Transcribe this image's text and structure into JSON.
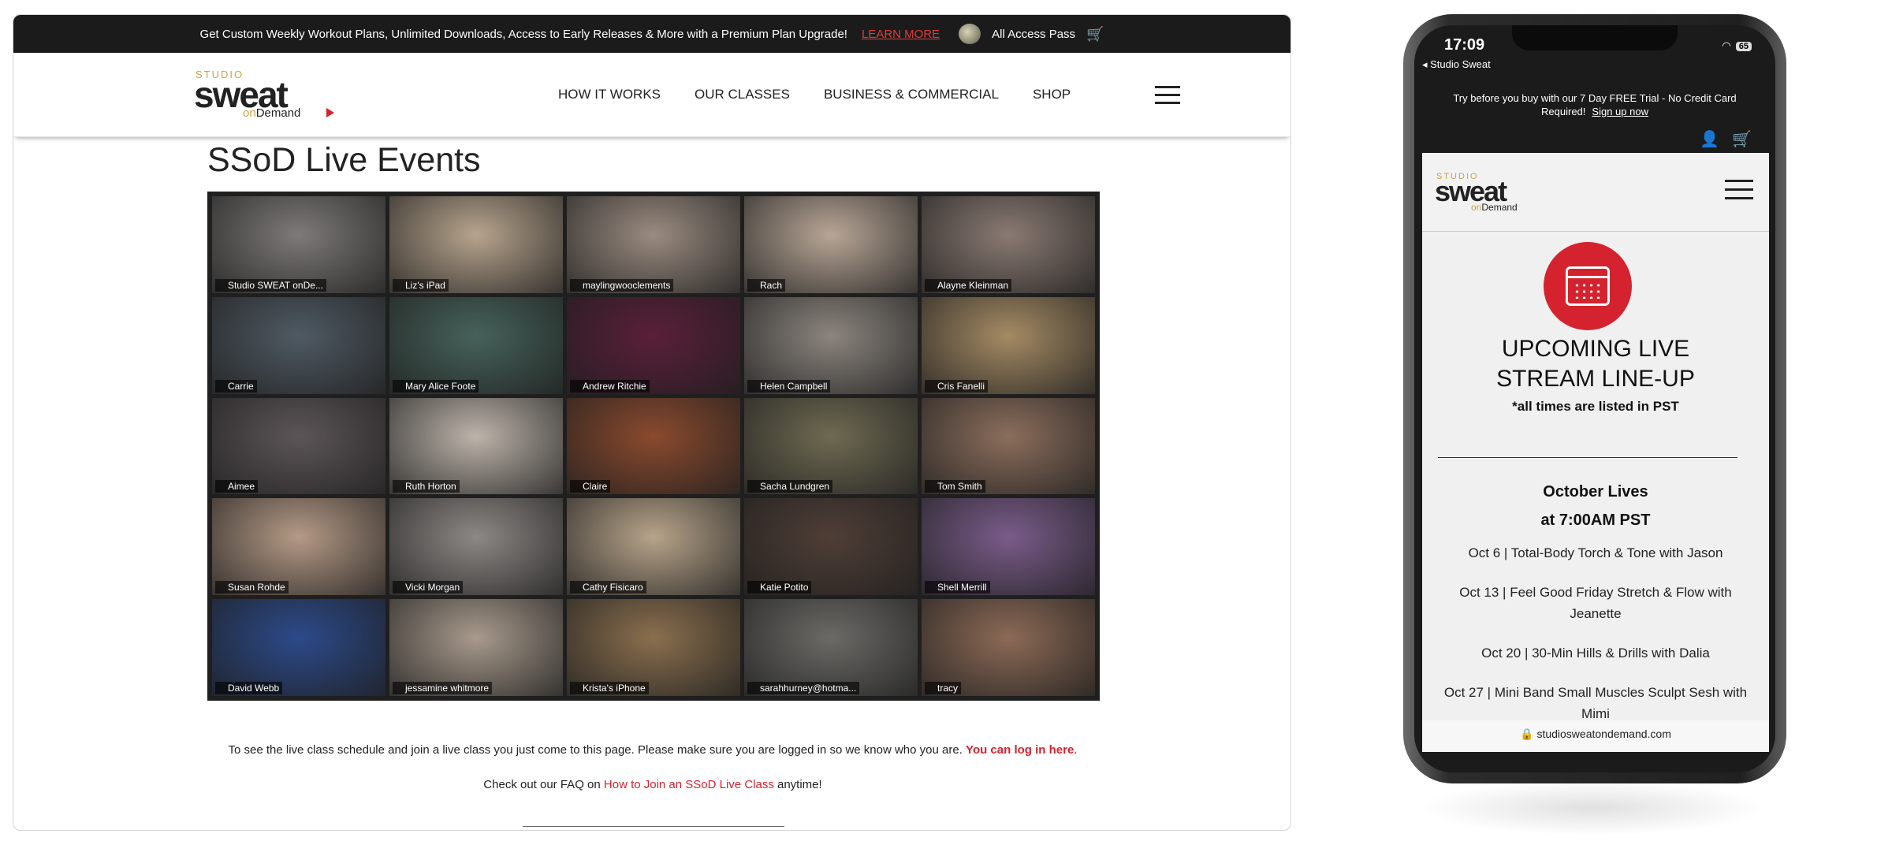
{
  "desktop": {
    "promo": {
      "message": "Get Custom Weekly Workout Plans, Unlimited Downloads, Access to Early Releases & More with a Premium Plan Upgrade!",
      "learn_more": "LEARN MORE",
      "pass": "All Access Pass"
    },
    "logo": {
      "studio": "STUDIO",
      "sweat": "sweat",
      "on": "on",
      "demand": "Demand"
    },
    "menu": [
      "HOW IT WORKS",
      "OUR CLASSES",
      "BUSINESS & COMMERCIAL",
      "SHOP"
    ],
    "page_title": "SSoD Live Events",
    "participants": [
      {
        "name": "Studio SWEAT onDe...",
        "color": "#7d7a78"
      },
      {
        "name": "Liz's iPad",
        "color": "#b7a48d"
      },
      {
        "name": "maylingwooclements",
        "color": "#9a8b80"
      },
      {
        "name": "Rach",
        "color": "#b8a696"
      },
      {
        "name": "Alayne Kleinman",
        "color": "#8a7a72"
      },
      {
        "name": "Carrie",
        "color": "#4f5a63"
      },
      {
        "name": "Mary Alice Foote",
        "color": "#46625a"
      },
      {
        "name": "Andrew Ritchie",
        "color": "#5a1f3a"
      },
      {
        "name": "Helen Campbell",
        "color": "#8c857e"
      },
      {
        "name": "Cris Fanelli",
        "color": "#a58b64"
      },
      {
        "name": "Aimee",
        "color": "#5c5558"
      },
      {
        "name": "Ruth Horton",
        "color": "#bdb4aa"
      },
      {
        "name": "Claire",
        "color": "#8a4a2e"
      },
      {
        "name": "Sacha Lundgren",
        "color": "#6f6a52"
      },
      {
        "name": "Tom Smith",
        "color": "#8b6e5c"
      },
      {
        "name": "Susan Rohde",
        "color": "#b59a86"
      },
      {
        "name": "Vicki Morgan",
        "color": "#8d8885"
      },
      {
        "name": "Cathy Fisicaro",
        "color": "#b7a48a"
      },
      {
        "name": "Katie Potito",
        "color": "#4f3e36"
      },
      {
        "name": "Shell Merrill",
        "color": "#7a5c8a"
      },
      {
        "name": "David Webb",
        "color": "#2c4a8a"
      },
      {
        "name": "jessamine whitmore",
        "color": "#a89a8c"
      },
      {
        "name": "Krista's iPhone",
        "color": "#8a6f4e"
      },
      {
        "name": "sarahhurney@hotma...",
        "color": "#6b6a66"
      },
      {
        "name": "tracy",
        "color": "#8c6a56"
      }
    ],
    "info_text": "To see the live class schedule and join a live class you just come to this page. Please make sure you are logged in so we know who you are.",
    "login_link": "You can log in here",
    "faq_prefix": "Check out our FAQ on",
    "faq_link": "How to Join an SSoD Live Class",
    "faq_suffix": "anytime!"
  },
  "phone": {
    "time": "17:09",
    "back": "◂ Studio Sweat",
    "battery": "65",
    "trial": "Try before you buy with our 7 Day FREE Trial - No Credit Card Required!",
    "signup": "Sign up now",
    "heading": "UPCOMING LIVE STREAM LINE-UP",
    "pst_note": "*all times are listed in PST",
    "month_title": "October Lives",
    "month_time": "at 7:00AM PST",
    "events": [
      "Oct 6  | Total-Body Torch & Tone with Jason",
      "Oct 13 | Feel Good Friday Stretch & Flow with Jeanette",
      "Oct 20  | 30-Min Hills & Drills with Dalia",
      "Oct 27  | Mini Band Small Muscles Sculpt Sesh with Mimi"
    ],
    "url": "studiosweatondemand.com"
  },
  "colors": {
    "accent": "#d4232e",
    "gold": "#c9a24a",
    "dark": "#1b1b1b"
  }
}
